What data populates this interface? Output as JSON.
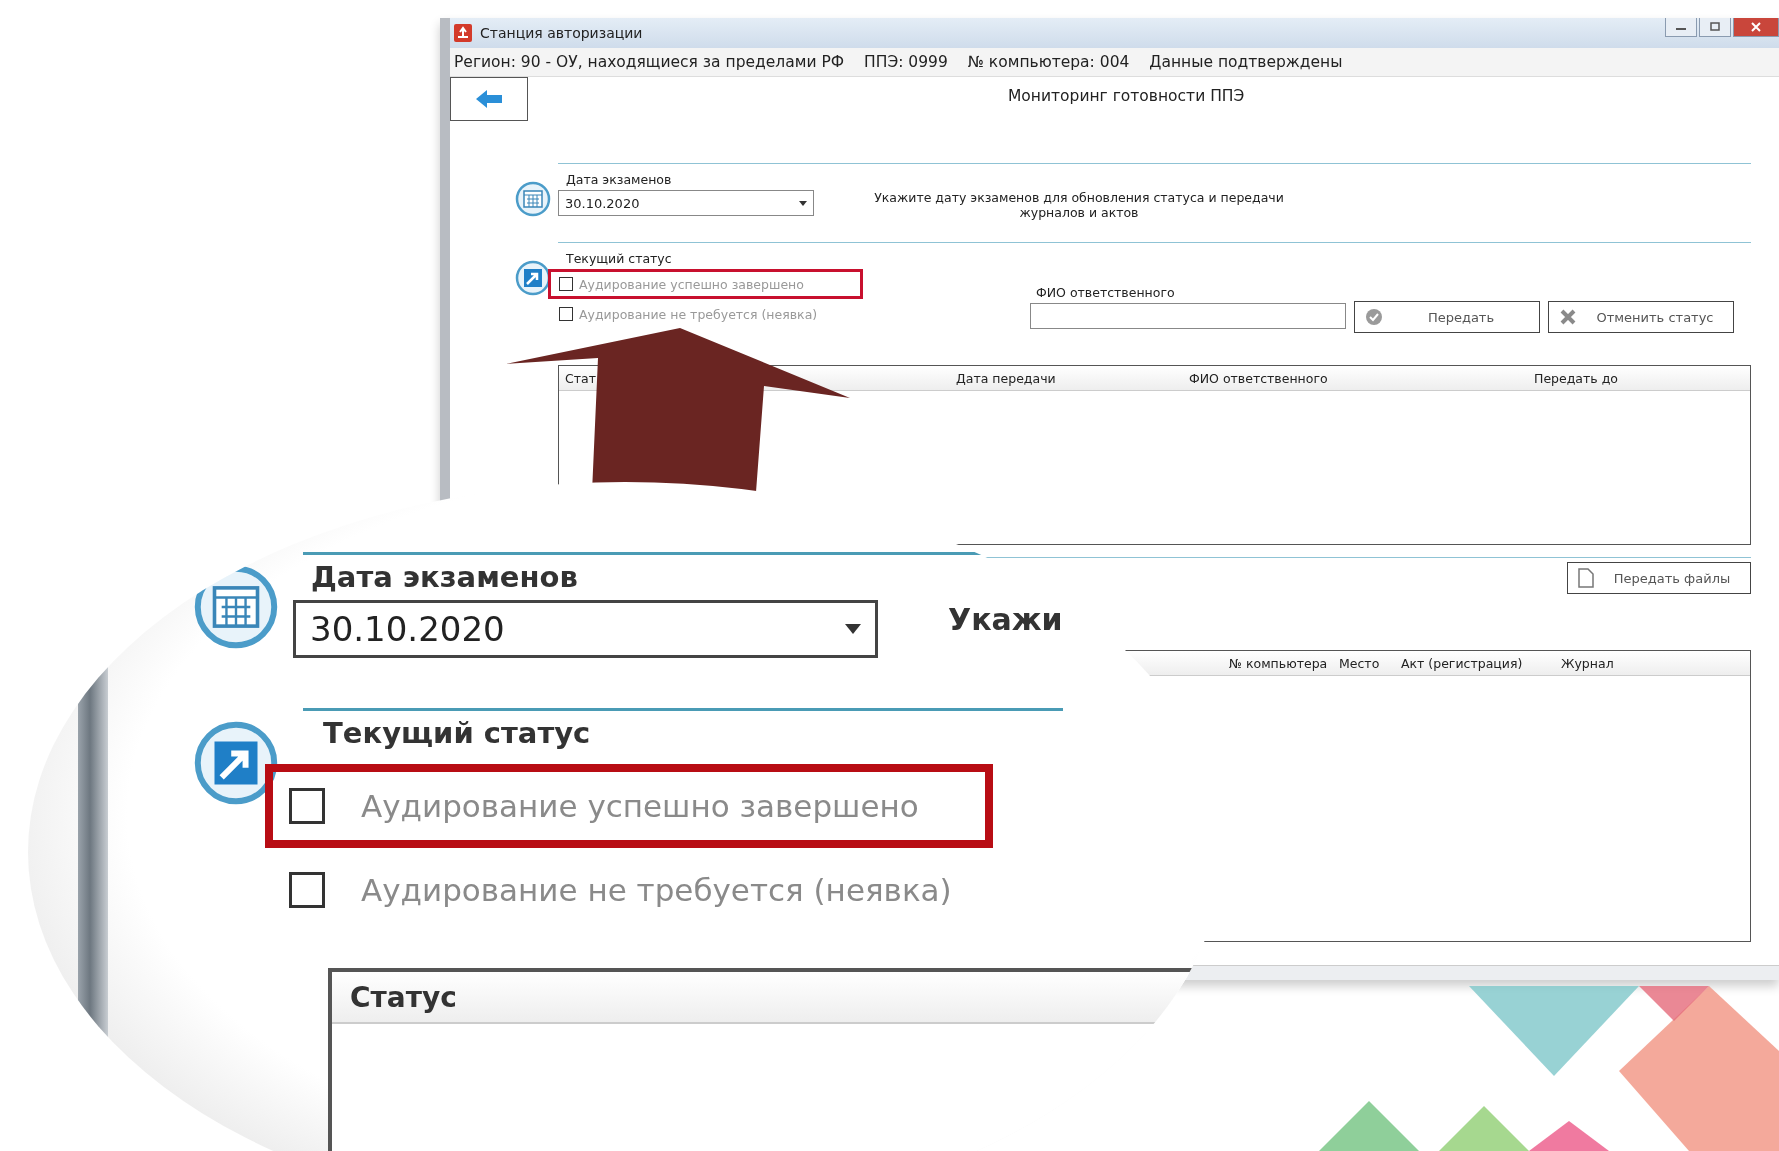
{
  "window": {
    "title": "Станция авторизации"
  },
  "info_bar": [
    "Регион: 90 - ОУ, находящиеся за пределами РФ",
    "ППЭ: 0999",
    "№ компьютера: 004",
    "Данные подтверждены"
  ],
  "page_title": "Мониторинг готовности ППЭ",
  "exam_date": {
    "label": "Дата экзаменов",
    "value": "30.10.2020",
    "hint": "Укажите дату экзаменов для обновления статуса и передачи журналов и актов"
  },
  "status": {
    "label": "Текущий статус",
    "options": [
      {
        "label": "Аудирование успешно завершено",
        "checked": false,
        "highlighted": true
      },
      {
        "label": "Аудирование не требуется (неявка)",
        "checked": false,
        "highlighted": false
      }
    ]
  },
  "responsible": {
    "label": "ФИО ответственного"
  },
  "buttons": [
    {
      "label": "Передать",
      "kind": "send"
    },
    {
      "label": "Отменить статус",
      "kind": "cancel"
    }
  ],
  "status_table": {
    "columns": [
      "Стат",
      "Дата передачи",
      "ФИО ответственного",
      "Передать до"
    ]
  },
  "files_button": {
    "label": "Передать файлы"
  },
  "files_table": {
    "columns": [
      "№ компьютера",
      "Место",
      "Акт (регистрация)",
      "Журнал"
    ]
  },
  "magnifier": {
    "date_label": "Дата экзаменов",
    "date_value": "30.10.2020",
    "hint": "Укажи",
    "status_label": "Текущий статус",
    "options": [
      {
        "label": "Аудирование успешно завершено",
        "checked": false,
        "highlighted": true
      },
      {
        "label": "Аудирование не требуется (неявка)",
        "checked": false,
        "highlighted": false
      }
    ],
    "table_column": "Статус"
  }
}
